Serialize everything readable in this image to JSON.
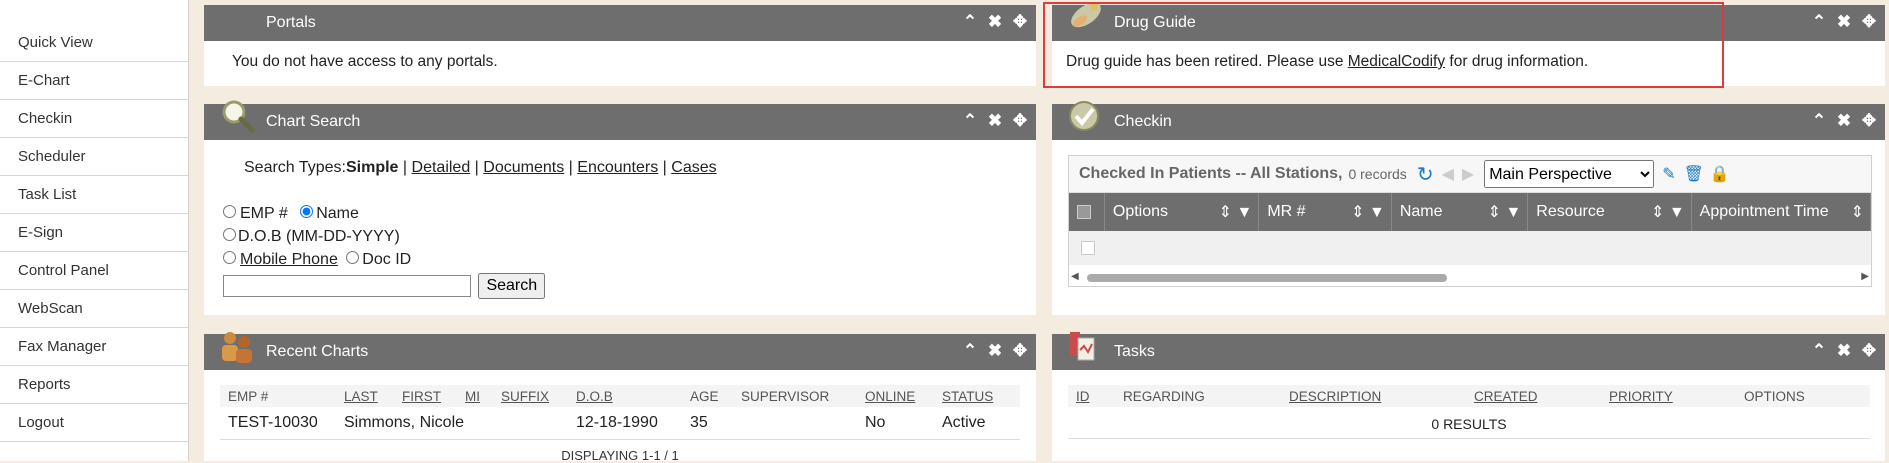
{
  "sidebar": {
    "items": [
      {
        "label": "Quick View"
      },
      {
        "label": "E-Chart"
      },
      {
        "label": "Checkin"
      },
      {
        "label": "Scheduler"
      },
      {
        "label": "Task List"
      },
      {
        "label": "E-Sign"
      },
      {
        "label": "Control Panel"
      },
      {
        "label": "WebScan"
      },
      {
        "label": "Fax Manager"
      },
      {
        "label": "Reports"
      },
      {
        "label": "Logout"
      }
    ]
  },
  "portals": {
    "title": "Portals",
    "message": "You do not have access to any portals."
  },
  "drug_guide": {
    "title": "Drug Guide",
    "message_before": "Drug guide has been retired. Please use ",
    "link": "MedicalCodify",
    "message_after": " for drug information.",
    "highlight_color": "#e0393e"
  },
  "chart_search": {
    "title": "Chart Search",
    "search_types_label": "Search Types:",
    "types": {
      "simple": "Simple",
      "detailed": "Detailed",
      "documents": "Documents",
      "encounters": "Encounters",
      "cases": "Cases"
    },
    "sep": "|",
    "options": {
      "emp": "EMP #",
      "name": "Name",
      "dob": "D.O.B (MM-DD-YYYY)",
      "mobile": "Mobile Phone",
      "docid": "Doc ID"
    },
    "selected": "Name",
    "search_value": "",
    "search_button": "Search"
  },
  "checkin": {
    "title": "Checkin",
    "grid_title": "Checked In Patients -- All Stations,",
    "records": "0 records",
    "perspective": "Main Perspective",
    "columns": [
      "Options",
      "MR #",
      "Name",
      "Resource",
      "Appointment Time"
    ]
  },
  "recent_charts": {
    "title": "Recent Charts",
    "columns": [
      "EMP #",
      "LAST",
      "FIRST",
      "MI",
      "SUFFIX",
      "D.O.B",
      "AGE",
      "SUPERVISOR",
      "ONLINE",
      "STATUS"
    ],
    "rows": [
      {
        "emp": "TEST-10030",
        "name": "Simmons, Nicole",
        "dob": "12-18-1990",
        "age": "35",
        "online": "No",
        "status": "Active"
      }
    ],
    "footer": "DISPLAYING 1-1 / 1"
  },
  "tasks": {
    "title": "Tasks",
    "columns": [
      "ID",
      "REGARDING",
      "DESCRIPTION",
      "CREATED",
      "PRIORITY",
      "OPTIONS"
    ],
    "results": "0 RESULTS"
  },
  "icons": {
    "collapse": "chevron-up-icon",
    "close": "close-icon",
    "move": "move-icon"
  }
}
